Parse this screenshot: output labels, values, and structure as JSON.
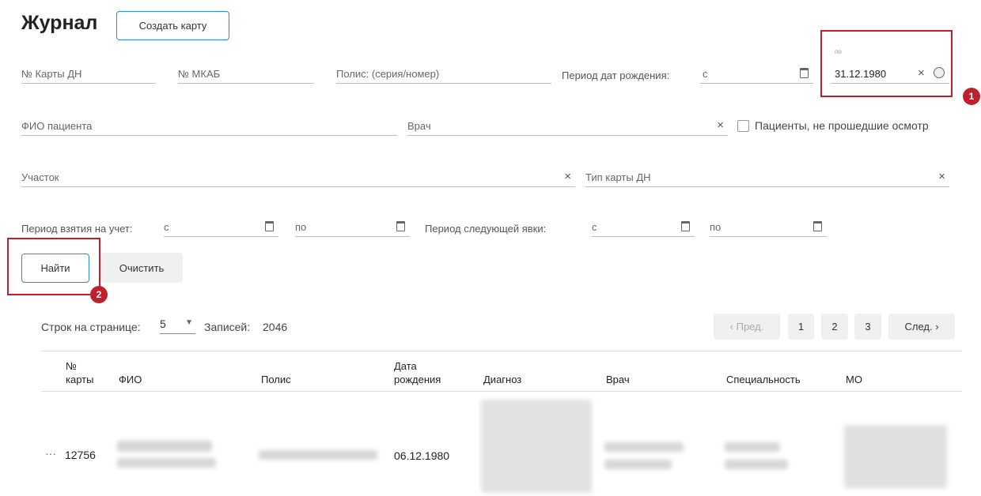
{
  "header": {
    "title": "Журнал",
    "create_card_label": "Создать карту"
  },
  "filters": {
    "card_dn": "№ Карты ДН",
    "mkab": "№ МКАБ",
    "policy": "Полис: (серия/номер)",
    "birth_period_label": "Период дат рождения:",
    "from": "с",
    "to_small": "по",
    "birth_to_value": "31.12.1980",
    "patient_name": "ФИО пациента",
    "doctor": "Врач",
    "not_examined": "Пациенты, не прошедшие осмотр",
    "district": "Участок",
    "card_type": "Тип карты ДН",
    "registration_period_label": "Период взятия на учет:",
    "next_visit_period_label": "Период следующей явки:",
    "to": "по"
  },
  "actions": {
    "find": "Найти",
    "clear": "Очистить"
  },
  "annotations": {
    "badge1": "1",
    "badge2": "2"
  },
  "pagination": {
    "rows_per_page_label": "Строк на странице:",
    "rows_per_page_value": "5",
    "records_label": "Записей:",
    "records_count": "2046",
    "prev": "‹ Пред.",
    "pages": [
      "1",
      "2",
      "3"
    ],
    "next": "След. ›"
  },
  "table": {
    "headers": {
      "card_no_1": "№",
      "card_no_2": "карты",
      "fio": "ФИО",
      "policy": "Полис",
      "birth_1": "Дата",
      "birth_2": "рождения",
      "diagnosis": "Диагноз",
      "doctor": "Врач",
      "specialty": "Специальность",
      "mo": "МО"
    },
    "rows": [
      {
        "menu": "···",
        "card_no": "12756",
        "birth_date": "06.12.1980"
      }
    ]
  },
  "colors": {
    "accent": "#2a8bd6",
    "annotation": "#c0202b"
  }
}
